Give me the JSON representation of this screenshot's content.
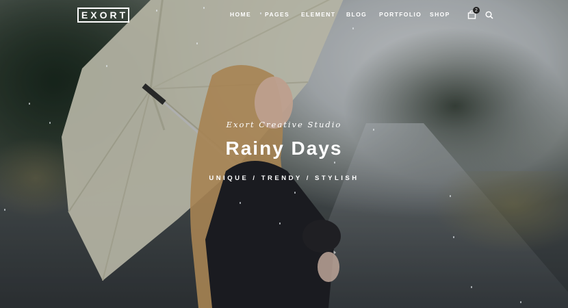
{
  "brand": {
    "logo_text": "EXORT"
  },
  "nav": {
    "items": [
      {
        "label": "HOME"
      },
      {
        "label": "PAGES"
      },
      {
        "label": "ELEMENT"
      },
      {
        "label": "BLOG"
      },
      {
        "label": "PORTFOLIO"
      },
      {
        "label": "SHOP"
      }
    ],
    "cart_count": "2",
    "cart_icon": "shopping-bag-icon",
    "search_icon": "search-icon"
  },
  "hero": {
    "subtitle": "Exort Creative Studio",
    "title": "Rainy Days",
    "tagline": "UNIQUE / TRENDY / STYLISH"
  }
}
